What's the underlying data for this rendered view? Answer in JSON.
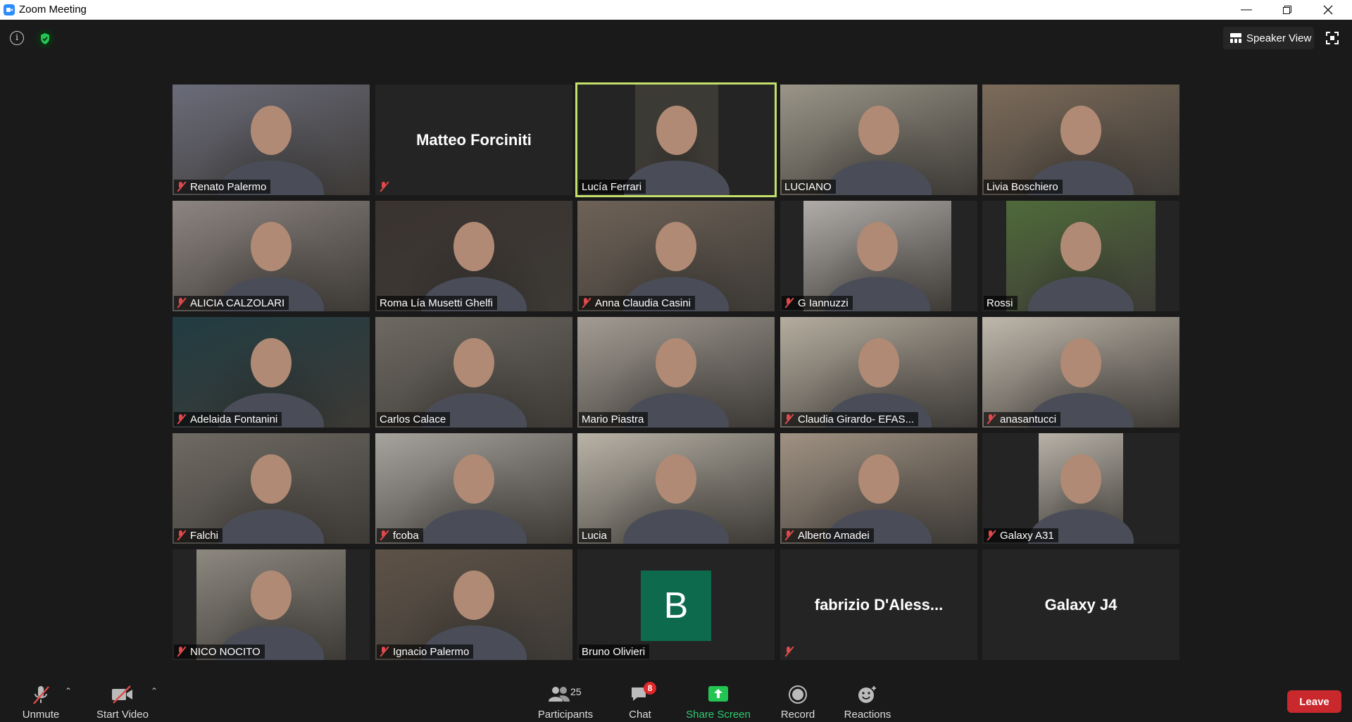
{
  "window": {
    "title": "Zoom Meeting"
  },
  "top_bar": {
    "view_label": "Speaker View"
  },
  "tiles": [
    {
      "name": "Renato Palermo",
      "muted": true,
      "bg": "#6b6c7a"
    },
    {
      "name": "",
      "display_name": "Matteo Forciniti",
      "muted": true,
      "bg": "#242424"
    },
    {
      "name": "Lucía Ferrari",
      "muted": false,
      "bg": "#3c3a33",
      "active": true
    },
    {
      "name": "LUCIANO",
      "muted": false,
      "bg": "#9a9588"
    },
    {
      "name": "Livia Boschiero",
      "muted": false,
      "bg": "#7c6b5a"
    },
    {
      "name": "ALICIA CALZOLARI",
      "muted": true,
      "bg": "#8c8480"
    },
    {
      "name": "Roma Lía Musetti Ghelfi",
      "muted": false,
      "bg": "#3a3330"
    },
    {
      "name": "Anna Claudia Casini",
      "muted": true,
      "bg": "#6e6257"
    },
    {
      "name": "G Iannuzzi",
      "muted": true,
      "bg": "#b0aca9"
    },
    {
      "name": "Rossi",
      "muted": false,
      "bg": "#4f6a3a"
    },
    {
      "name": "Adelaida Fontanini",
      "muted": true,
      "bg": "#213c42"
    },
    {
      "name": "Carlos Calace",
      "muted": false,
      "bg": "#6e6962"
    },
    {
      "name": "Mario Piastra",
      "muted": false,
      "bg": "#a39c94"
    },
    {
      "name": "Claudia Girardo- EFAS...",
      "muted": true,
      "bg": "#b5ad9f"
    },
    {
      "name": "anasantucci",
      "muted": true,
      "bg": "#c0b8ac"
    },
    {
      "name": "Falchi",
      "muted": true,
      "bg": "#6f6a63"
    },
    {
      "name": "fcoba",
      "muted": true,
      "bg": "#a7a39d"
    },
    {
      "name": "Lucia",
      "muted": false,
      "bg": "#b9b3a7"
    },
    {
      "name": "Alberto Amadei",
      "muted": true,
      "bg": "#a09283"
    },
    {
      "name": "Galaxy A31",
      "muted": true,
      "bg": "#b8b2a8"
    },
    {
      "name": "NICO NOCITO",
      "muted": true,
      "bg": "#8d8880"
    },
    {
      "name": "Ignacio Palermo",
      "muted": true,
      "bg": "#5e5247"
    },
    {
      "name": "Bruno Olivieri",
      "muted": false,
      "bg": "#242424",
      "avatar_letter": "B"
    },
    {
      "name": "",
      "display_name": "fabrizio  D'Aless...",
      "muted": true,
      "bg": "#242424"
    },
    {
      "name": "",
      "display_name": "Galaxy J4",
      "muted": false,
      "bg": "#242424"
    }
  ],
  "toolbar": {
    "unmute_label": "Unmute",
    "start_video_label": "Start Video",
    "participants_label": "Participants",
    "participants_count": "25",
    "chat_label": "Chat",
    "chat_badge": "8",
    "share_screen_label": "Share Screen",
    "record_label": "Record",
    "reactions_label": "Reactions",
    "leave_label": "Leave"
  },
  "colors": {
    "accent_active": "#c3e06a",
    "leave": "#c9282d",
    "share": "#2ecc71",
    "mute": "#e0494b"
  }
}
